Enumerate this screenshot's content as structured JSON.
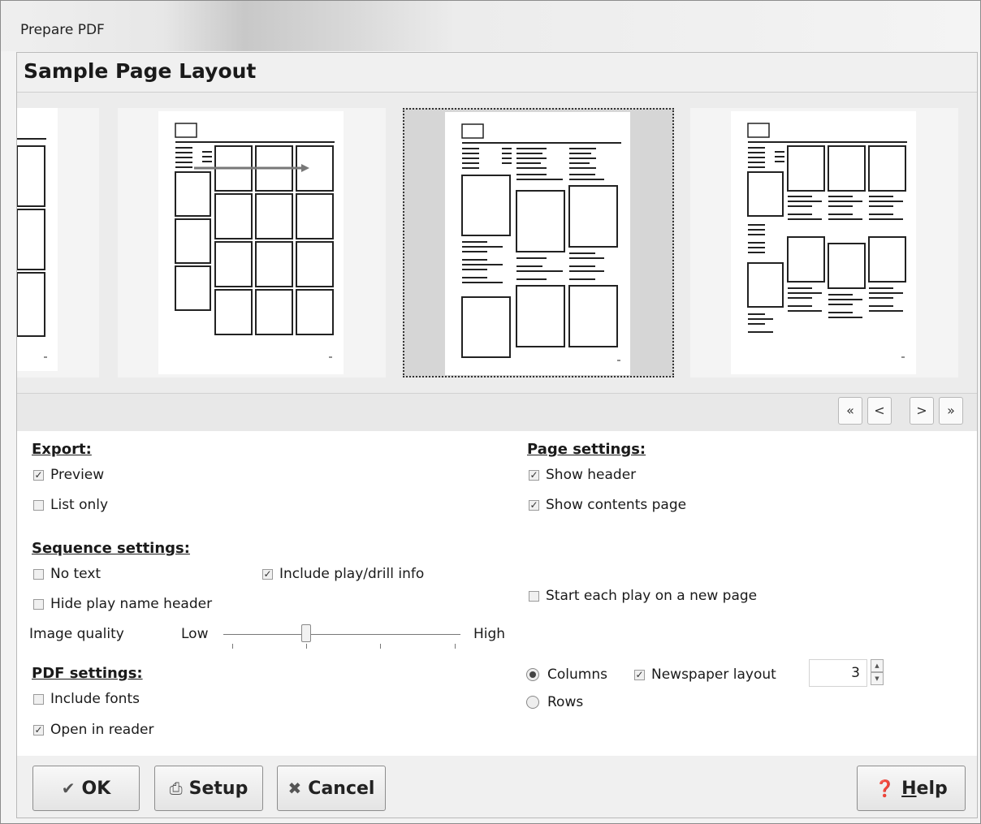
{
  "window": {
    "title": "Prepare PDF"
  },
  "header": {
    "title": "Sample Page Layout"
  },
  "gallery": {
    "thumbnails": [
      {
        "name": "layout-partial-left"
      },
      {
        "name": "layout-grid-rows"
      },
      {
        "name": "layout-newspaper-columns",
        "selected": true
      },
      {
        "name": "layout-columns"
      }
    ]
  },
  "nav": {
    "first": "«",
    "prev": "<",
    "next": ">",
    "last": "»"
  },
  "export": {
    "title": "Export:",
    "preview": {
      "label": "Preview",
      "checked": true
    },
    "list_only": {
      "label": "List only",
      "checked": false
    }
  },
  "page_settings": {
    "title": "Page settings:",
    "show_header": {
      "label": "Show header",
      "checked": true
    },
    "show_contents": {
      "label": "Show contents page",
      "checked": true
    },
    "start_new_page": {
      "label": "Start each play on a new page",
      "checked": false
    }
  },
  "sequence_settings": {
    "title": "Sequence settings:",
    "no_text": {
      "label": "No text",
      "checked": false
    },
    "include_info": {
      "label": "Include play/drill info",
      "checked": true
    },
    "hide_header": {
      "label": "Hide play name header",
      "checked": false
    },
    "image_quality": {
      "label": "Image quality",
      "low": "Low",
      "high": "High",
      "level": 0.333
    }
  },
  "pdf_settings": {
    "title": "PDF settings:",
    "include_fonts": {
      "label": "Include fonts",
      "checked": false
    },
    "open_reader": {
      "label": "Open in reader",
      "checked": true
    }
  },
  "layout": {
    "columns": {
      "label": "Columns",
      "selected": true
    },
    "rows": {
      "label": "Rows",
      "selected": false
    },
    "newspaper": {
      "label": "Newspaper layout",
      "checked": true
    },
    "count": "3"
  },
  "footer": {
    "ok": "OK",
    "setup": "Setup",
    "cancel": "Cancel",
    "help_first": "H",
    "help_rest": "elp"
  }
}
